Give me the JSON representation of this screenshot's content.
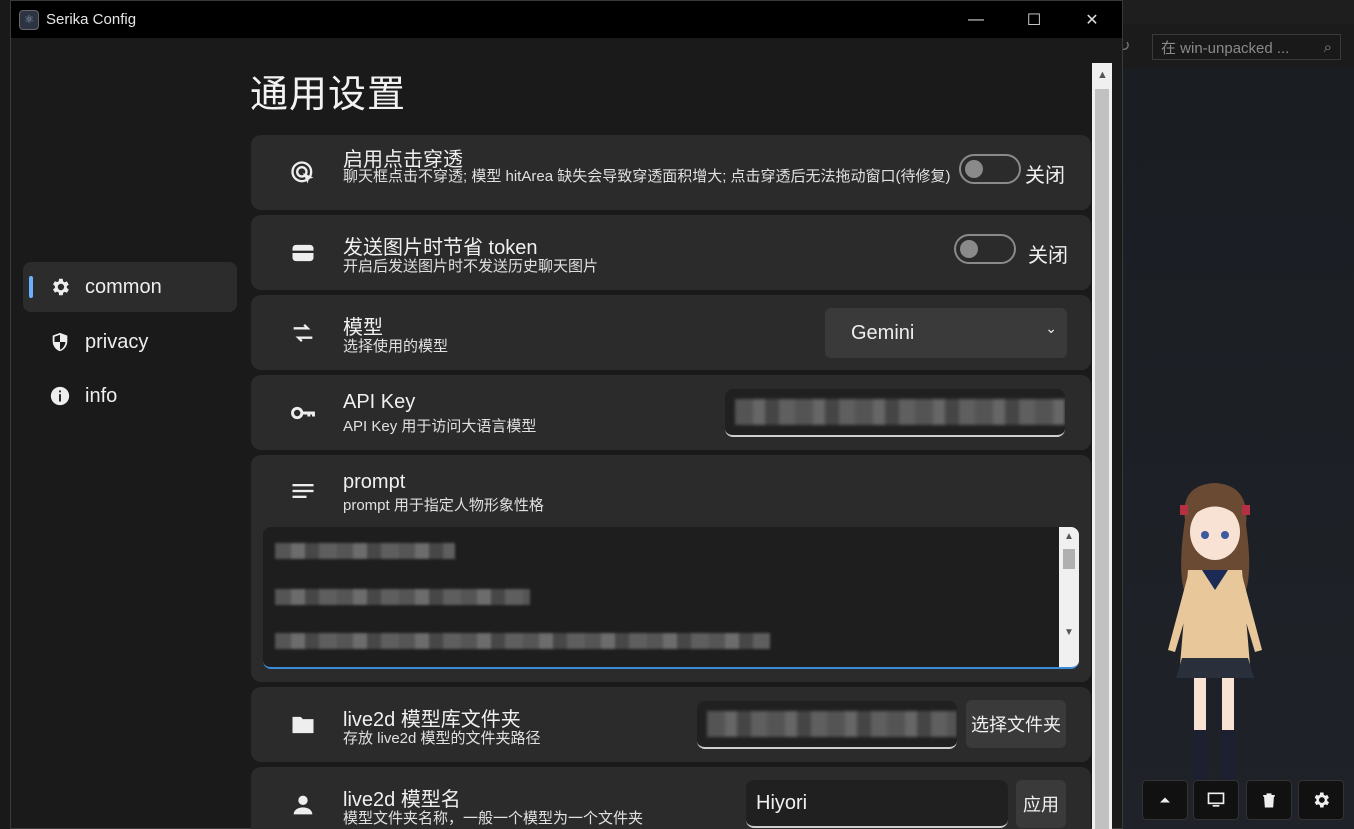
{
  "window": {
    "title": "Serika Config"
  },
  "background_app": {
    "search_placeholder": "在 win-unpacked ..."
  },
  "sidebar": {
    "items": [
      {
        "label": "common",
        "icon": "gear-icon",
        "active": true
      },
      {
        "label": "privacy",
        "icon": "shield-icon",
        "active": false
      },
      {
        "label": "info",
        "icon": "info-icon",
        "active": false
      }
    ]
  },
  "page": {
    "title": "通用设置",
    "settings": [
      {
        "title": "启用点击穿透",
        "desc": "聊天框点击不穿透; 模型 hitArea 缺失会导致穿透面积增大; 点击穿透后无法拖动窗口(待修复)",
        "control": "toggle",
        "state": "关闭",
        "icon": "click-through-icon"
      },
      {
        "title": "发送图片时节省 token",
        "desc": "开启后发送图片时不发送历史聊天图片",
        "control": "toggle",
        "state": "关闭",
        "icon": "wallet-icon"
      },
      {
        "title": "模型",
        "desc": "选择使用的模型",
        "control": "select",
        "value": "Gemini",
        "icon": "swap-icon"
      },
      {
        "title": "API Key",
        "desc": "API Key 用于访问大语言模型",
        "control": "input",
        "icon": "key-icon"
      },
      {
        "title": "prompt",
        "desc": "prompt 用于指定人物形象性格",
        "control": "textarea",
        "icon": "notes-icon"
      },
      {
        "title": "live2d 模型库文件夹",
        "desc": "存放 live2d 模型的文件夹路径",
        "control": "input+button",
        "button": "选择文件夹",
        "icon": "folder-icon"
      },
      {
        "title": "live2d 模型名",
        "desc": "模型文件夹名称，一般一个模型为一个文件夹",
        "control": "input+button",
        "value": "Hiyori",
        "button": "应用",
        "icon": "person-icon"
      }
    ]
  },
  "colors": {
    "accent": "#6ab0ff",
    "card": "#2b2b2b",
    "window_bg": "#1a1a1a"
  }
}
